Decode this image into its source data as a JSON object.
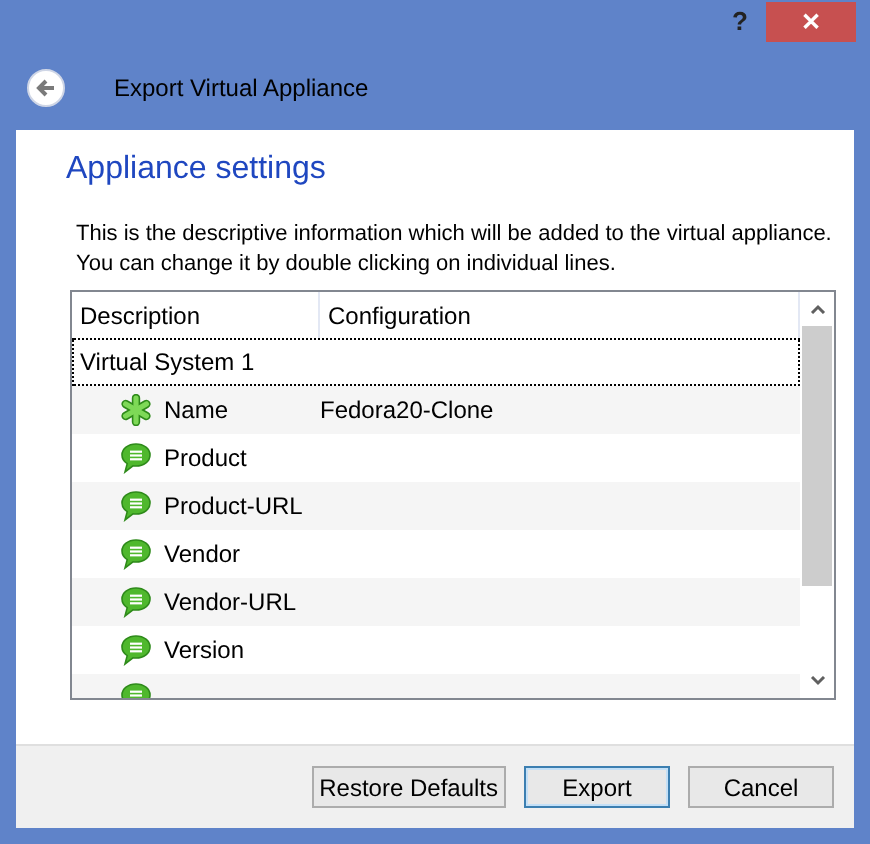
{
  "window": {
    "title": "Export Virtual Appliance",
    "help": "?",
    "close": "✕"
  },
  "page": {
    "heading": "Appliance settings",
    "intro": [
      "This is the descriptive information which will be added to the virtual appliance.",
      "You can change it by double clicking on individual lines."
    ]
  },
  "table": {
    "columns": [
      "Description",
      "Configuration"
    ],
    "group": {
      "label": "Virtual System 1",
      "focused": true
    },
    "rows": [
      {
        "kind": "required",
        "description": "Name",
        "configuration": "Fedora20-Clone"
      },
      {
        "kind": "text",
        "description": "Product"
      },
      {
        "kind": "text",
        "description": "Product-URL"
      },
      {
        "kind": "text",
        "description": "Vendor"
      },
      {
        "kind": "text",
        "description": "Vendor-URL"
      },
      {
        "kind": "text",
        "description": "Version"
      },
      {
        "kind": "text"
      }
    ]
  },
  "buttons": [
    {
      "label": "Restore Defaults",
      "default": false
    },
    {
      "label": "Export",
      "default": true
    },
    {
      "label": "Cancel",
      "default": false
    }
  ]
}
